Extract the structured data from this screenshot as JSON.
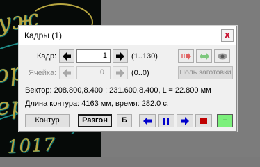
{
  "dialog": {
    "title": "Кадры (1)",
    "close_label": "x"
  },
  "frame_row": {
    "label": "Кадр:",
    "value": "1",
    "range": "(1..130)"
  },
  "cell_row": {
    "label": "Ячейка:",
    "value": "0",
    "range": "(0..0)",
    "blanks_button": "Ноль заготовки"
  },
  "info": {
    "vector": "Вектор: 208.800,8.400 : 231.600,8.400, L = 22.800 мм",
    "contour": "Длина контура: 4163 мм, время: 282.0 с."
  },
  "bottom_bar": {
    "contour_button": "Контур",
    "razgon_button": "Разгон",
    "b_button": "Б",
    "plus_button": "+"
  },
  "background_text": [
    "уж",
    "ори",
    "ере",
    "1017"
  ],
  "colors": {
    "stop_red": "#c00000",
    "plus_green": "#7cf07c",
    "arrow_blue": "#0000cc"
  }
}
